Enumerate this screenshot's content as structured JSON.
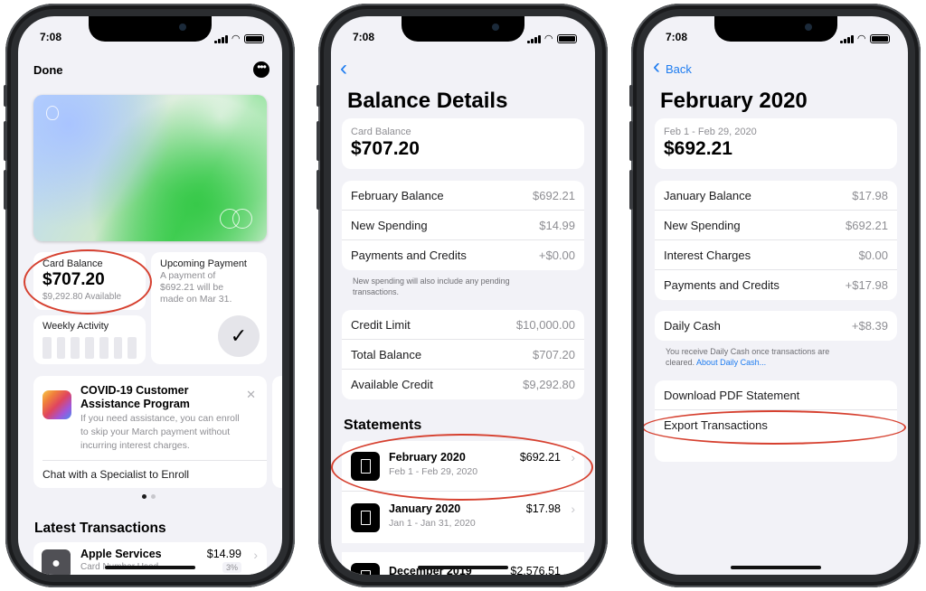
{
  "status": {
    "time": "7:08"
  },
  "phone1": {
    "done": "Done",
    "balance_label": "Card Balance",
    "balance_value": "$707.20",
    "balance_available": "$9,292.80 Available",
    "upcoming_title": "Upcoming Payment",
    "upcoming_line1": "A payment of",
    "upcoming_line2": "$692.21 will be",
    "upcoming_line3": "made on Mar 31.",
    "weekly_activity": "Weekly Activity",
    "covid_title_1": "COVID-19 Customer",
    "covid_title_2": "Assistance Program",
    "covid_body_1": "If you need assistance, you can enroll",
    "covid_body_2": "to skip your March payment without",
    "covid_body_3": "incurring interest charges.",
    "chat": "Chat with a Specialist to Enroll",
    "latest": "Latest Transactions",
    "txn_name": "Apple Services",
    "txn_amount": "$14.99",
    "txn_sub": "Card Number Used",
    "txn_pct": "3%"
  },
  "phone2": {
    "title": "Balance Details",
    "card_label": "Card Balance",
    "card_value": "$707.20",
    "group1": [
      {
        "label": "February Balance",
        "value": "$692.21"
      },
      {
        "label": "New Spending",
        "value": "$14.99"
      },
      {
        "label": "Payments and Credits",
        "value": "+$0.00"
      }
    ],
    "note_1": "New spending will also include any pending",
    "note_2": "transactions.",
    "group2": [
      {
        "label": "Credit Limit",
        "value": "$10,000.00"
      },
      {
        "label": "Total Balance",
        "value": "$707.20"
      },
      {
        "label": "Available Credit",
        "value": "$9,292.80"
      }
    ],
    "statements": "Statements",
    "stmts": [
      {
        "name": "February 2020",
        "range": "Feb 1 - Feb 29, 2020",
        "amount": "$692.21"
      },
      {
        "name": "January 2020",
        "range": "Jan 1 - Jan 31, 2020",
        "amount": "$17.98"
      },
      {
        "name": "December 2019",
        "range": "",
        "amount": "$2,576.51"
      }
    ]
  },
  "phone3": {
    "back": "Back",
    "title": "February 2020",
    "range": "Feb 1 - Feb 29, 2020",
    "value": "$692.21",
    "group1": [
      {
        "label": "January Balance",
        "value": "$17.98"
      },
      {
        "label": "New Spending",
        "value": "$692.21"
      },
      {
        "label": "Interest Charges",
        "value": "$0.00"
      },
      {
        "label": "Payments and Credits",
        "value": "+$17.98"
      }
    ],
    "daily_cash_label": "Daily Cash",
    "daily_cash_value": "+$8.39",
    "note_1": "You receive Daily Cash once transactions are",
    "note_2": "cleared.",
    "note_link": "About Daily Cash...",
    "download": "Download PDF Statement",
    "export": "Export Transactions"
  },
  "colors": {
    "accent": "#1e7cf0",
    "highlight": "#d6402f",
    "background": "#f2f2f7"
  }
}
